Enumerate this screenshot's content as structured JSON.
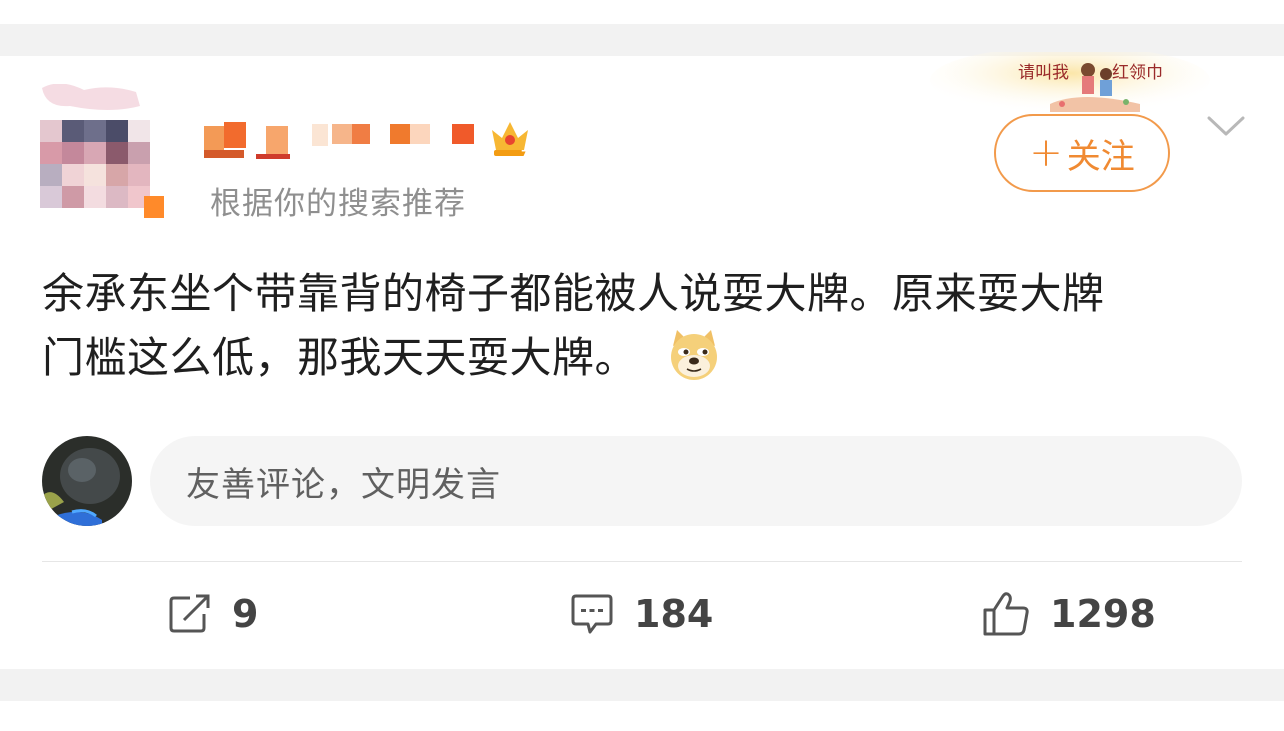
{
  "post": {
    "subtitle": "根据你的搜索推荐",
    "follow_label": "关注",
    "follow_plus": "+",
    "banner": {
      "left_text": "请叫我",
      "right_text": "红领巾"
    },
    "text_line1": "余承东坐个带靠背的椅子都能被人说耍大牌。原来耍大牌",
    "text_line2": "门槛这么低，那我天天耍大牌。",
    "emoji": "doge-emoji"
  },
  "comment_box": {
    "placeholder": "友善评论，文明发言"
  },
  "actions": {
    "repost_count": "9",
    "comment_count": "184",
    "like_count": "1298"
  },
  "colors": {
    "accent": "#f08a32",
    "text": "#1f1f1f",
    "muted": "#8f8f8f",
    "gap": "#f2f2f2"
  }
}
